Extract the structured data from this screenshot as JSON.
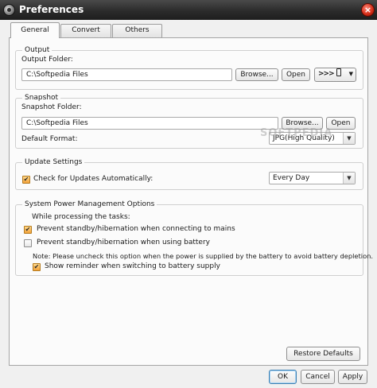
{
  "window": {
    "title": "Preferences",
    "close_glyph": "×"
  },
  "tabs": [
    {
      "label": "General",
      "active": true
    },
    {
      "label": "Convert",
      "active": false
    },
    {
      "label": "Others",
      "active": false
    }
  ],
  "output": {
    "group_label": "Output",
    "folder_label": "Output Folder:",
    "folder_value": "C:\\Softpedia Files",
    "browse_label": "Browse...",
    "open_label": "Open",
    "device_glyph": ">>>"
  },
  "snapshot": {
    "group_label": "Snapshot",
    "folder_label": "Snapshot Folder:",
    "folder_value": "C:\\Softpedia Files",
    "browse_label": "Browse...",
    "open_label": "Open",
    "format_label": "Default Format:",
    "format_value": "JPG(High Quality)",
    "watermark": "SOFTPEDIA"
  },
  "update": {
    "group_label": "Update Settings",
    "check_label": "Check for Updates Automatically:",
    "check_checked": true,
    "frequency_value": "Every Day"
  },
  "power": {
    "group_label": "System Power Management Options",
    "while_label": "While processing the tasks:",
    "prevent_mains_label": "Prevent standby/hibernation when connecting to mains",
    "prevent_mains_checked": true,
    "prevent_battery_label": "Prevent standby/hibernation when using battery",
    "prevent_battery_checked": false,
    "note": "Note: Please uncheck this option when the power is supplied by the battery to avoid battery depletion.",
    "reminder_label": "Show reminder when switching to battery supply",
    "reminder_checked": true
  },
  "restore_label": "Restore Defaults",
  "footer": {
    "ok_label": "OK",
    "cancel_label": "Cancel",
    "apply_label": "Apply"
  },
  "check_glyph": "✔",
  "dropdown_glyph": "▼"
}
